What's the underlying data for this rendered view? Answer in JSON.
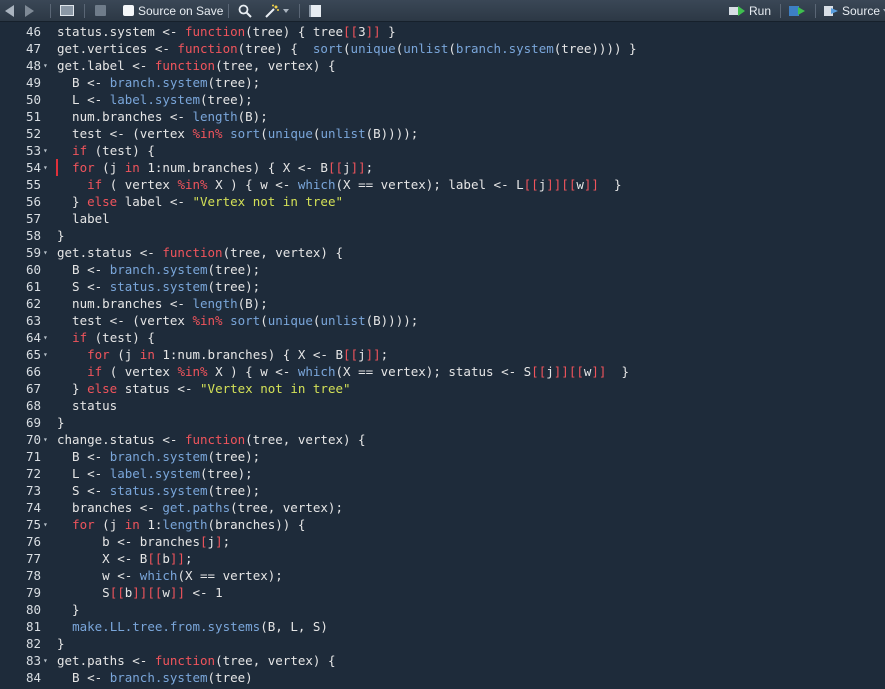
{
  "toolbar": {
    "source_on_save_label": "Source on Save",
    "run_label": "Run",
    "source_label": "Source",
    "icons": [
      "back-arrow-icon",
      "forward-arrow-icon",
      "show-in-window-icon",
      "save-icon",
      "search-icon",
      "magic-wand-icon",
      "compile-report-icon",
      "run-icon",
      "rerun-icon",
      "source-icon"
    ]
  },
  "colors": {
    "background": "#1e2b3a",
    "keyword": "#f0545c",
    "function": "#7aa6da",
    "string": "#d4e157",
    "text": "#e6e6e6"
  },
  "editor": {
    "lines": [
      {
        "n": "46",
        "fold": false,
        "tokens": [
          [
            "t",
            "status.system <- "
          ],
          [
            "kw",
            "function"
          ],
          [
            "t",
            "(tree) { tree"
          ],
          [
            "br",
            "[["
          ],
          [
            "t",
            "3"
          ],
          [
            "br",
            "]]"
          ],
          [
            "t",
            " }"
          ]
        ]
      },
      {
        "n": "47",
        "fold": false,
        "tokens": [
          [
            "t",
            "get.vertices <- "
          ],
          [
            "kw",
            "function"
          ],
          [
            "t",
            "(tree) {  "
          ],
          [
            "fn",
            "sort"
          ],
          [
            "t",
            "("
          ],
          [
            "fn",
            "unique"
          ],
          [
            "t",
            "("
          ],
          [
            "fn",
            "unlist"
          ],
          [
            "t",
            "("
          ],
          [
            "fn",
            "branch.system"
          ],
          [
            "t",
            "(tree)))) }"
          ]
        ]
      },
      {
        "n": "48",
        "fold": true,
        "tokens": [
          [
            "t",
            "get.label <- "
          ],
          [
            "kw",
            "function"
          ],
          [
            "t",
            "(tree, vertex) {"
          ]
        ]
      },
      {
        "n": "49",
        "fold": false,
        "tokens": [
          [
            "t",
            "  B <- "
          ],
          [
            "fn",
            "branch.system"
          ],
          [
            "t",
            "(tree);"
          ]
        ]
      },
      {
        "n": "50",
        "fold": false,
        "tokens": [
          [
            "t",
            "  L <- "
          ],
          [
            "fn",
            "label.system"
          ],
          [
            "t",
            "(tree);"
          ]
        ]
      },
      {
        "n": "51",
        "fold": false,
        "tokens": [
          [
            "t",
            "  num.branches <- "
          ],
          [
            "fn",
            "length"
          ],
          [
            "t",
            "(B);"
          ]
        ]
      },
      {
        "n": "52",
        "fold": false,
        "tokens": [
          [
            "t",
            "  test <- (vertex "
          ],
          [
            "kw",
            "%in%"
          ],
          [
            "t",
            " "
          ],
          [
            "fn",
            "sort"
          ],
          [
            "t",
            "("
          ],
          [
            "fn",
            "unique"
          ],
          [
            "t",
            "("
          ],
          [
            "fn",
            "unlist"
          ],
          [
            "t",
            "(B))));"
          ]
        ]
      },
      {
        "n": "53",
        "fold": true,
        "tokens": [
          [
            "t",
            "  "
          ],
          [
            "kw",
            "if"
          ],
          [
            "t",
            " (test) {"
          ]
        ]
      },
      {
        "n": "54",
        "fold": true,
        "marker": true,
        "tokens": [
          [
            "t",
            "  "
          ],
          [
            "kw",
            "for"
          ],
          [
            "t",
            " (j "
          ],
          [
            "kw",
            "in"
          ],
          [
            "t",
            " 1:num.branches) { X <- B"
          ],
          [
            "br",
            "[["
          ],
          [
            "t",
            "j"
          ],
          [
            "br",
            "]]"
          ],
          [
            "t",
            ";"
          ]
        ]
      },
      {
        "n": "55",
        "fold": false,
        "tokens": [
          [
            "t",
            "    "
          ],
          [
            "kw",
            "if"
          ],
          [
            "t",
            " ( vertex "
          ],
          [
            "kw",
            "%in%"
          ],
          [
            "t",
            " X ) { w <- "
          ],
          [
            "fn",
            "which"
          ],
          [
            "t",
            "(X == vertex); label <- L"
          ],
          [
            "br",
            "[["
          ],
          [
            "t",
            "j"
          ],
          [
            "br",
            "]][["
          ],
          [
            "t",
            "w"
          ],
          [
            "br",
            "]]"
          ],
          [
            "t",
            "  }"
          ]
        ]
      },
      {
        "n": "56",
        "fold": false,
        "tokens": [
          [
            "t",
            "  } "
          ],
          [
            "kw",
            "else"
          ],
          [
            "t",
            " label <- "
          ],
          [
            "str",
            "\"Vertex not in tree\""
          ]
        ]
      },
      {
        "n": "57",
        "fold": false,
        "tokens": [
          [
            "t",
            "  label"
          ]
        ]
      },
      {
        "n": "58",
        "fold": false,
        "tokens": [
          [
            "t",
            "}"
          ]
        ]
      },
      {
        "n": "59",
        "fold": true,
        "tokens": [
          [
            "t",
            "get.status <- "
          ],
          [
            "kw",
            "function"
          ],
          [
            "t",
            "(tree, vertex) {"
          ]
        ]
      },
      {
        "n": "60",
        "fold": false,
        "tokens": [
          [
            "t",
            "  B <- "
          ],
          [
            "fn",
            "branch.system"
          ],
          [
            "t",
            "(tree);"
          ]
        ]
      },
      {
        "n": "61",
        "fold": false,
        "tokens": [
          [
            "t",
            "  S <- "
          ],
          [
            "fn",
            "status.system"
          ],
          [
            "t",
            "(tree);"
          ]
        ]
      },
      {
        "n": "62",
        "fold": false,
        "tokens": [
          [
            "t",
            "  num.branches <- "
          ],
          [
            "fn",
            "length"
          ],
          [
            "t",
            "(B);"
          ]
        ]
      },
      {
        "n": "63",
        "fold": false,
        "tokens": [
          [
            "t",
            "  test <- (vertex "
          ],
          [
            "kw",
            "%in%"
          ],
          [
            "t",
            " "
          ],
          [
            "fn",
            "sort"
          ],
          [
            "t",
            "("
          ],
          [
            "fn",
            "unique"
          ],
          [
            "t",
            "("
          ],
          [
            "fn",
            "unlist"
          ],
          [
            "t",
            "(B))));"
          ]
        ]
      },
      {
        "n": "64",
        "fold": true,
        "tokens": [
          [
            "t",
            "  "
          ],
          [
            "kw",
            "if"
          ],
          [
            "t",
            " (test) {"
          ]
        ]
      },
      {
        "n": "65",
        "fold": true,
        "tokens": [
          [
            "t",
            "    "
          ],
          [
            "kw",
            "for"
          ],
          [
            "t",
            " (j "
          ],
          [
            "kw",
            "in"
          ],
          [
            "t",
            " 1:num.branches) { X <- B"
          ],
          [
            "br",
            "[["
          ],
          [
            "t",
            "j"
          ],
          [
            "br",
            "]]"
          ],
          [
            "t",
            ";"
          ]
        ]
      },
      {
        "n": "66",
        "fold": false,
        "tokens": [
          [
            "t",
            "    "
          ],
          [
            "kw",
            "if"
          ],
          [
            "t",
            " ( vertex "
          ],
          [
            "kw",
            "%in%"
          ],
          [
            "t",
            " X ) { w <- "
          ],
          [
            "fn",
            "which"
          ],
          [
            "t",
            "(X == vertex); status <- S"
          ],
          [
            "br",
            "[["
          ],
          [
            "t",
            "j"
          ],
          [
            "br",
            "]][["
          ],
          [
            "t",
            "w"
          ],
          [
            "br",
            "]]"
          ],
          [
            "t",
            "  }"
          ]
        ]
      },
      {
        "n": "67",
        "fold": false,
        "tokens": [
          [
            "t",
            "  } "
          ],
          [
            "kw",
            "else"
          ],
          [
            "t",
            " status <- "
          ],
          [
            "str",
            "\"Vertex not in tree\""
          ]
        ]
      },
      {
        "n": "68",
        "fold": false,
        "tokens": [
          [
            "t",
            "  status"
          ]
        ]
      },
      {
        "n": "69",
        "fold": false,
        "tokens": [
          [
            "t",
            "}"
          ]
        ]
      },
      {
        "n": "70",
        "fold": true,
        "tokens": [
          [
            "t",
            "change.status <- "
          ],
          [
            "kw",
            "function"
          ],
          [
            "t",
            "(tree, vertex) {"
          ]
        ]
      },
      {
        "n": "71",
        "fold": false,
        "tokens": [
          [
            "t",
            "  B <- "
          ],
          [
            "fn",
            "branch.system"
          ],
          [
            "t",
            "(tree);"
          ]
        ]
      },
      {
        "n": "72",
        "fold": false,
        "tokens": [
          [
            "t",
            "  L <- "
          ],
          [
            "fn",
            "label.system"
          ],
          [
            "t",
            "(tree);"
          ]
        ]
      },
      {
        "n": "73",
        "fold": false,
        "tokens": [
          [
            "t",
            "  S <- "
          ],
          [
            "fn",
            "status.system"
          ],
          [
            "t",
            "(tree);"
          ]
        ]
      },
      {
        "n": "74",
        "fold": false,
        "tokens": [
          [
            "t",
            "  branches <- "
          ],
          [
            "fn",
            "get.paths"
          ],
          [
            "t",
            "(tree, vertex);"
          ]
        ]
      },
      {
        "n": "75",
        "fold": true,
        "tokens": [
          [
            "t",
            "  "
          ],
          [
            "kw",
            "for"
          ],
          [
            "t",
            " (j "
          ],
          [
            "kw",
            "in"
          ],
          [
            "t",
            " 1:"
          ],
          [
            "fn",
            "length"
          ],
          [
            "t",
            "(branches)) {"
          ]
        ]
      },
      {
        "n": "76",
        "fold": false,
        "tokens": [
          [
            "t",
            "      b <- branches"
          ],
          [
            "br",
            "["
          ],
          [
            "t",
            "j"
          ],
          [
            "br",
            "]"
          ],
          [
            "t",
            ";"
          ]
        ]
      },
      {
        "n": "77",
        "fold": false,
        "tokens": [
          [
            "t",
            "      X <- B"
          ],
          [
            "br",
            "[["
          ],
          [
            "t",
            "b"
          ],
          [
            "br",
            "]]"
          ],
          [
            "t",
            ";"
          ]
        ]
      },
      {
        "n": "78",
        "fold": false,
        "tokens": [
          [
            "t",
            "      w <- "
          ],
          [
            "fn",
            "which"
          ],
          [
            "t",
            "(X == vertex);"
          ]
        ]
      },
      {
        "n": "79",
        "fold": false,
        "tokens": [
          [
            "t",
            "      S"
          ],
          [
            "br",
            "[["
          ],
          [
            "t",
            "b"
          ],
          [
            "br",
            "]][["
          ],
          [
            "t",
            "w"
          ],
          [
            "br",
            "]]"
          ],
          [
            "t",
            " <- 1"
          ]
        ]
      },
      {
        "n": "80",
        "fold": false,
        "tokens": [
          [
            "t",
            "  }"
          ]
        ]
      },
      {
        "n": "81",
        "fold": false,
        "tokens": [
          [
            "t",
            "  "
          ],
          [
            "fn",
            "make.LL.tree.from.systems"
          ],
          [
            "t",
            "(B, L, S)"
          ]
        ]
      },
      {
        "n": "82",
        "fold": false,
        "tokens": [
          [
            "t",
            "}"
          ]
        ]
      },
      {
        "n": "83",
        "fold": true,
        "tokens": [
          [
            "t",
            "get.paths <- "
          ],
          [
            "kw",
            "function"
          ],
          [
            "t",
            "(tree, vertex) {"
          ]
        ]
      },
      {
        "n": "84",
        "fold": false,
        "tokens": [
          [
            "t",
            "  B <- "
          ],
          [
            "fn",
            "branch.system"
          ],
          [
            "t",
            "(tree)"
          ]
        ]
      }
    ]
  }
}
